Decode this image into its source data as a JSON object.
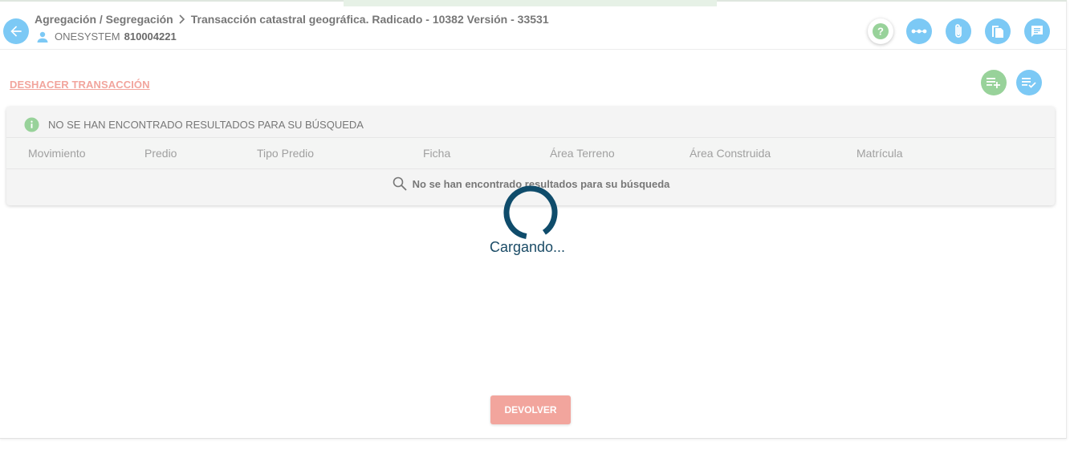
{
  "header": {
    "breadcrumb": {
      "parent": "Agregación / Segregación",
      "current": "Transacción catastral geográfica. Radicado - 10382 Versión - 33531"
    },
    "user": {
      "name": "ONESYSTEM",
      "code": "810004221"
    },
    "actions": [
      {
        "name": "help-button",
        "icon": "question-icon"
      },
      {
        "name": "workflow-button",
        "icon": "dots-icon"
      },
      {
        "name": "attachments-button",
        "icon": "paperclip-icon"
      },
      {
        "name": "documents-button",
        "icon": "document-icon"
      },
      {
        "name": "notes-button",
        "icon": "message-icon"
      }
    ]
  },
  "toolbar": {
    "undo_label": "DESHACER TRANSACCIÓN",
    "add_icon": "playlist-add-icon",
    "check_icon": "playlist-check-icon"
  },
  "results": {
    "info_message": "NO SE HAN ENCONTRADO RESULTADOS PARA SU BÚSQUEDA",
    "columns": [
      "Movimiento",
      "Predio",
      "Tipo Predio",
      "Ficha",
      "Área Terreno",
      "Área Construida",
      "Matrícula"
    ],
    "empty_message": "No se han encontrado resultados para su búsqueda"
  },
  "loading": {
    "text": "Cargando..."
  },
  "footer": {
    "return_label": "DEVOLVER"
  },
  "colors": {
    "accent_blue": "#7cc9f5",
    "accent_green": "#98d29a",
    "danger_salmon": "#f2a59d",
    "spinner": "#0f4c6b"
  }
}
